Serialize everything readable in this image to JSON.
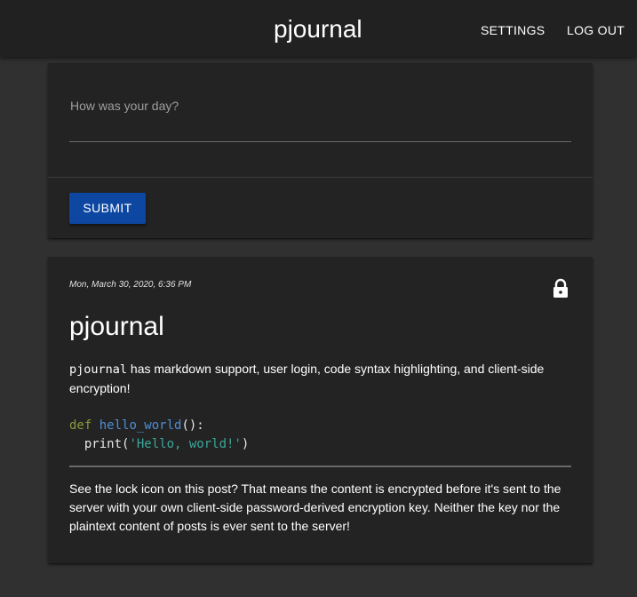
{
  "header": {
    "title": "pjournal",
    "settings_label": "SETTINGS",
    "logout_label": "LOG OUT"
  },
  "compose": {
    "placeholder": "How was your day?",
    "submit_label": "SUBMIT"
  },
  "post": {
    "date": "Mon, March 30, 2020, 6:36 PM",
    "title": "pjournal",
    "locked_icon": "lock-icon",
    "intro_code": "pjournal",
    "intro_text": " has markdown support, user login, code syntax highlighting, and client-side encryption!",
    "code": {
      "keyword": "def",
      "function": "hello_world",
      "parens": "():",
      "indent": "  ",
      "call": "print(",
      "string": "'Hello, world!'",
      "close": ")"
    },
    "outro": "See the lock icon on this post? That means the content is encrypted before it's sent to the server with your own client-side password-derived encryption key. Neither the key nor the plaintext content of posts is ever sent to the server!"
  },
  "colors": {
    "background": "#303030",
    "appbar": "#212121",
    "card": "#232323",
    "accent": "#0d47a1"
  }
}
